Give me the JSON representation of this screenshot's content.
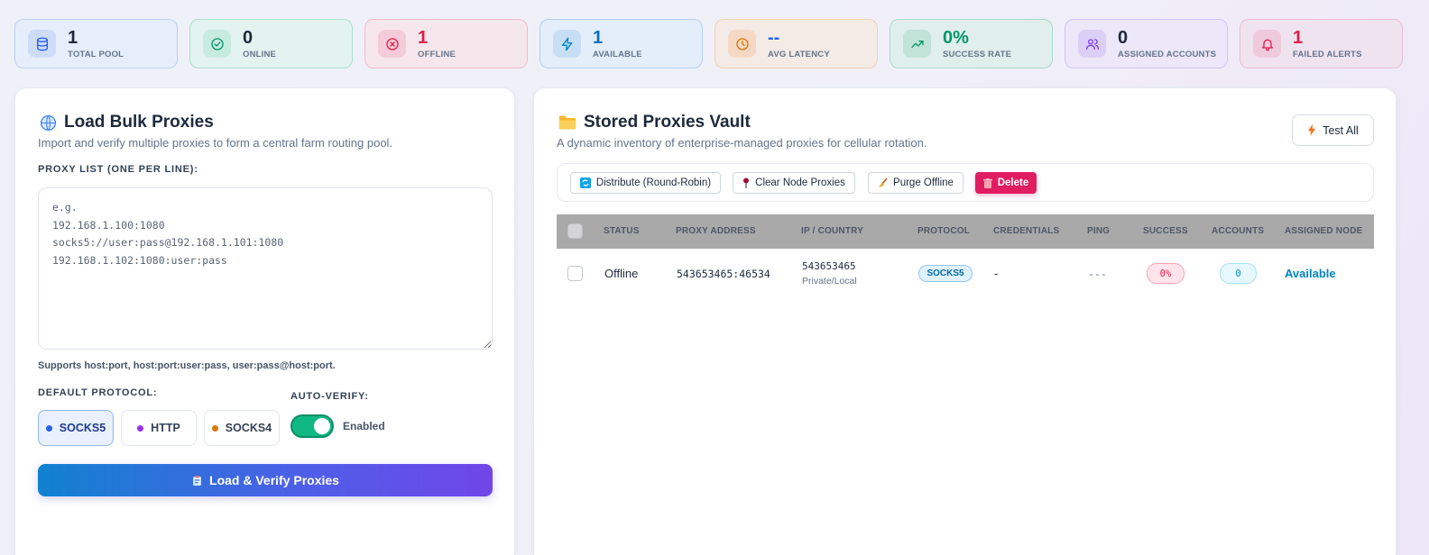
{
  "stats": [
    {
      "value": "1",
      "label": "TOTAL POOL",
      "icon": "database-icon",
      "accent": "#2563eb"
    },
    {
      "value": "0",
      "label": "ONLINE",
      "icon": "check-circle-icon",
      "accent": "#059669"
    },
    {
      "value": "1",
      "label": "OFFLINE",
      "icon": "x-circle-icon",
      "accent": "#e11d48"
    },
    {
      "value": "1",
      "label": "AVAILABLE",
      "icon": "lightning-icon",
      "accent": "#0284c7"
    },
    {
      "value": "--",
      "label": "AVG LATENCY",
      "icon": "clock-icon",
      "accent": "#2563eb"
    },
    {
      "value": "0%",
      "label": "SUCCESS RATE",
      "icon": "trending-up-icon",
      "accent": "#059669"
    },
    {
      "value": "0",
      "label": "ASSIGNED ACCOUNTS",
      "icon": "users-icon",
      "accent": "#7c3aed"
    },
    {
      "value": "1",
      "label": "FAILED ALERTS",
      "icon": "bell-icon",
      "accent": "#e11d48"
    }
  ],
  "load": {
    "title": "Load Bulk Proxies",
    "subtitle": "Import and verify multiple proxies to form a central farm routing pool.",
    "list_label": "PROXY LIST (ONE PER LINE):",
    "placeholder": "e.g.\n192.168.1.100:1080\nsocks5://user:pass@192.168.1.101:1080\n192.168.1.102:1080:user:pass",
    "hint": "Supports host:port, host:port:user:pass, user:pass@host:port.",
    "protocol_label": "DEFAULT PROTOCOL:",
    "protocols": [
      {
        "label": "SOCKS5",
        "color": "#2563eb",
        "selected": true
      },
      {
        "label": "HTTP",
        "color": "#9333ea",
        "selected": false
      },
      {
        "label": "SOCKS4",
        "color": "#d97706",
        "selected": false
      }
    ],
    "autoverify_label": "AUTO-VERIFY:",
    "autoverify_state": "Enabled",
    "autoverify_on": true,
    "submit_label": "Load & Verify Proxies"
  },
  "vault": {
    "title": "Stored Proxies Vault",
    "subtitle": "A dynamic inventory of enterprise-managed proxies for cellular rotation.",
    "test_all_label": "Test All",
    "actions": {
      "distribute": "Distribute (Round-Robin)",
      "clear": "Clear Node Proxies",
      "purge": "Purge Offline",
      "delete": "Delete"
    },
    "columns": [
      "STATUS",
      "PROXY ADDRESS",
      "IP / COUNTRY",
      "PROTOCOL",
      "CREDENTIALS",
      "PING",
      "SUCCESS",
      "ACCOUNTS",
      "ASSIGNED NODE"
    ],
    "rows": [
      {
        "status": "Offline",
        "address": "543653465:46534",
        "ip": "543653465",
        "country": "Private/Local",
        "protocol": "SOCKS5",
        "credentials": "-",
        "ping": "---",
        "success": "0%",
        "accounts": "0",
        "node": "Available"
      }
    ]
  }
}
